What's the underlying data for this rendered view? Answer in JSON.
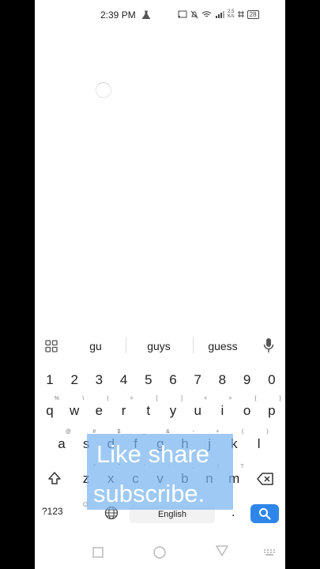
{
  "status_bar": {
    "time": "2:39 PM",
    "net_speed_value": "2.5",
    "net_speed_unit": "K/s",
    "battery": "28"
  },
  "suggestions": [
    "gu",
    "guys",
    "guess"
  ],
  "keyboard": {
    "number_row": [
      "1",
      "2",
      "3",
      "4",
      "5",
      "6",
      "7",
      "8",
      "9",
      "0"
    ],
    "row1": [
      {
        "k": "q",
        "s": "%"
      },
      {
        "k": "w",
        "s": "\\"
      },
      {
        "k": "e",
        "s": "|"
      },
      {
        "k": "r",
        "s": "="
      },
      {
        "k": "t",
        "s": "["
      },
      {
        "k": "y",
        "s": "]"
      },
      {
        "k": "u",
        "s": "<"
      },
      {
        "k": "i",
        "s": ">"
      },
      {
        "k": "o",
        "s": "{"
      },
      {
        "k": "p",
        "s": "}"
      }
    ],
    "row2": [
      {
        "k": "a",
        "s": "@"
      },
      {
        "k": "s",
        "s": "#"
      },
      {
        "k": "d",
        "s": "$"
      },
      {
        "k": "f",
        "s": "_"
      },
      {
        "k": "g",
        "s": "&"
      },
      {
        "k": "h",
        "s": "-"
      },
      {
        "k": "j",
        "s": "+"
      },
      {
        "k": "k",
        "s": "("
      },
      {
        "k": "l",
        "s": ")"
      }
    ],
    "row3": [
      {
        "k": "z",
        "s": "*"
      },
      {
        "k": "x",
        "s": "\""
      },
      {
        "k": "c",
        "s": "'"
      },
      {
        "k": "v",
        "s": ":"
      },
      {
        "k": "b",
        "s": ";"
      },
      {
        "k": "n",
        "s": "!"
      },
      {
        "k": "m",
        "s": "?"
      }
    ],
    "symbols_label": "?123",
    "space_label": "English",
    "period": "."
  },
  "overlay": {
    "line1": "Like share",
    "line2": "subscribe."
  }
}
